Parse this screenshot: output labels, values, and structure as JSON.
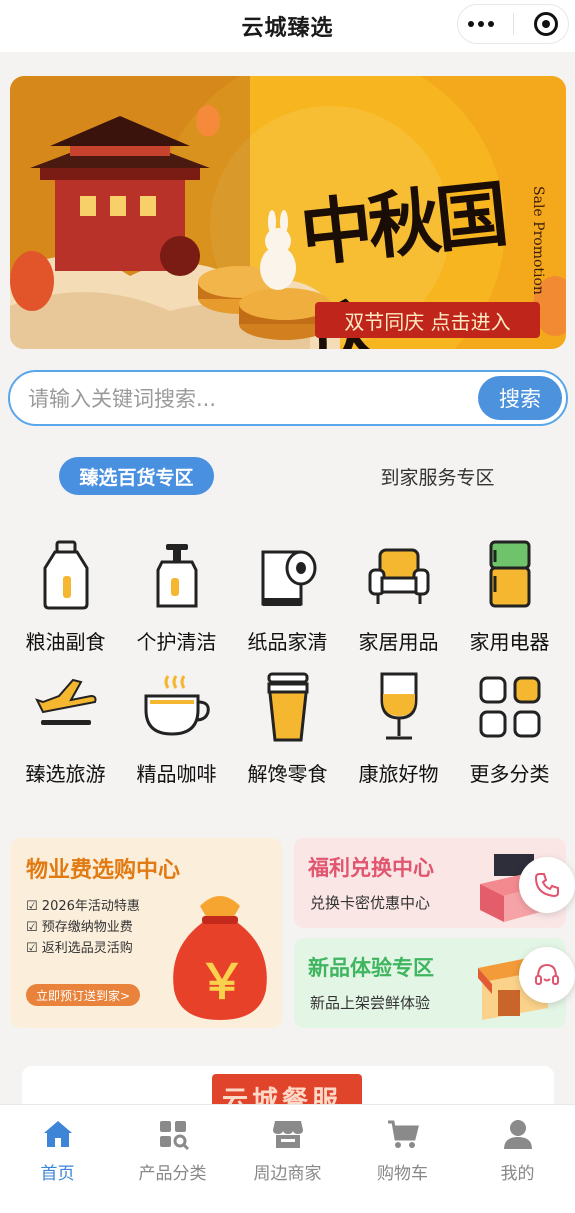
{
  "app": {
    "title": "云城臻选"
  },
  "banner": {
    "headline": "中秋国庆",
    "side_text": "Sale Promotion",
    "button_label": "双节同庆 点击进入"
  },
  "search": {
    "placeholder": "请输入关键词搜索...",
    "button_label": "搜索"
  },
  "tabs": [
    {
      "label": "臻选百货专区",
      "active": true
    },
    {
      "label": "到家服务专区",
      "active": false
    }
  ],
  "categories": [
    {
      "label": "粮油副食",
      "icon": "oil-bottle-icon"
    },
    {
      "label": "个护清洁",
      "icon": "pump-bottle-icon"
    },
    {
      "label": "纸品家清",
      "icon": "toilet-paper-icon"
    },
    {
      "label": "家居用品",
      "icon": "armchair-icon"
    },
    {
      "label": "家用电器",
      "icon": "refrigerator-icon"
    },
    {
      "label": "臻选旅游",
      "icon": "airplane-icon"
    },
    {
      "label": "精品咖啡",
      "icon": "coffee-cup-icon"
    },
    {
      "label": "解馋零食",
      "icon": "drink-cup-icon"
    },
    {
      "label": "康旅好物",
      "icon": "wine-glass-icon"
    },
    {
      "label": "更多分类",
      "icon": "grid-icon"
    }
  ],
  "promo_left": {
    "title": "物业费选购中心",
    "items": [
      "2026年活动特惠",
      "预存缴纳物业费",
      "返利选品灵活购"
    ],
    "cta": "立即预订送到家>",
    "currency_symbol": "￥"
  },
  "promo_right_top": {
    "title": "福利兑换中心",
    "subtitle": "兑换卡密优惠中心"
  },
  "promo_right_bottom": {
    "title": "新品体验专区",
    "subtitle": "新品上架尝鲜体验"
  },
  "bottom_banner_peek": {
    "text": "云城餐服"
  },
  "tabbar": [
    {
      "label": "首页",
      "icon": "home-icon",
      "active": true
    },
    {
      "label": "产品分类",
      "icon": "category-icon",
      "active": false
    },
    {
      "label": "周边商家",
      "icon": "store-icon",
      "active": false
    },
    {
      "label": "购物车",
      "icon": "cart-icon",
      "active": false
    },
    {
      "label": "我的",
      "icon": "user-icon",
      "active": false
    }
  ],
  "colors": {
    "accent": "#4a90e0",
    "orange": "#e27a12",
    "red": "#c0251b"
  }
}
